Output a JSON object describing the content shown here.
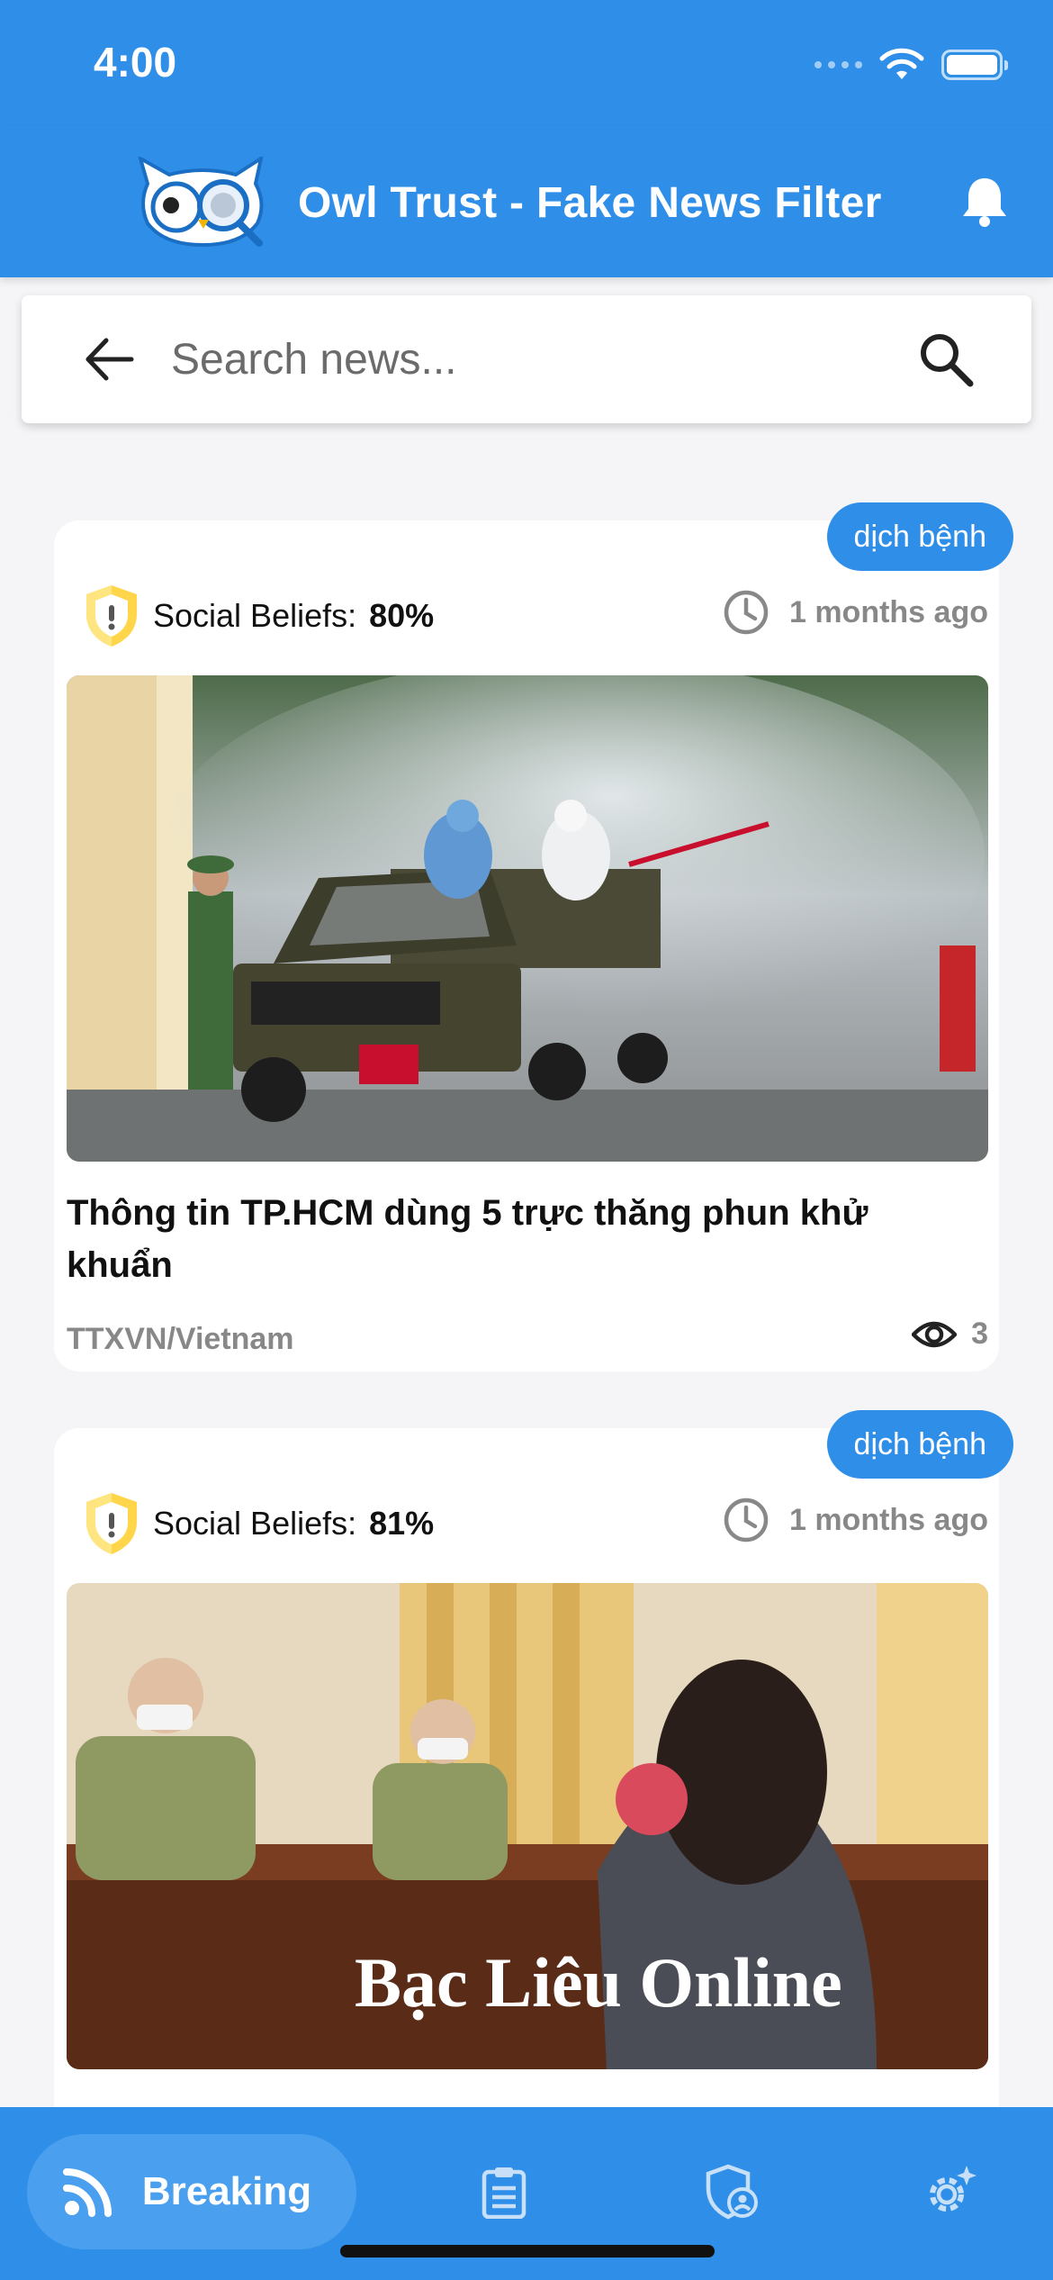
{
  "status_bar": {
    "time": "4:00"
  },
  "app_bar": {
    "title": "Owl Trust - Fake News Filter"
  },
  "search": {
    "placeholder": "Search news..."
  },
  "colors": {
    "primary": "#2f8fe8",
    "shield_yellow": "#ffd54a",
    "muted_text": "#888888"
  },
  "articles": [
    {
      "tag": "dịch bệnh",
      "beliefs_label": "Social Beliefs:",
      "beliefs_value": "80%",
      "time_ago": "1 months ago",
      "title": "Thông tin TP.HCM dùng 5 trực thăng phun khử khuẩn",
      "source": "TTXVN/Vietnam",
      "views": "3"
    },
    {
      "tag": "dịch bệnh",
      "beliefs_label": "Social Beliefs:",
      "beliefs_value": "81%",
      "time_ago": "1 months ago",
      "title": "",
      "source": "",
      "views": "",
      "image_watermark": "Bạc Liêu Online"
    }
  ],
  "bottom_nav": {
    "items": [
      {
        "label": "Breaking",
        "icon": "rss-icon",
        "active": true
      },
      {
        "label": "",
        "icon": "clipboard-icon",
        "active": false
      },
      {
        "label": "",
        "icon": "shield-user-icon",
        "active": false
      },
      {
        "label": "",
        "icon": "gear-icon",
        "active": false
      }
    ]
  }
}
